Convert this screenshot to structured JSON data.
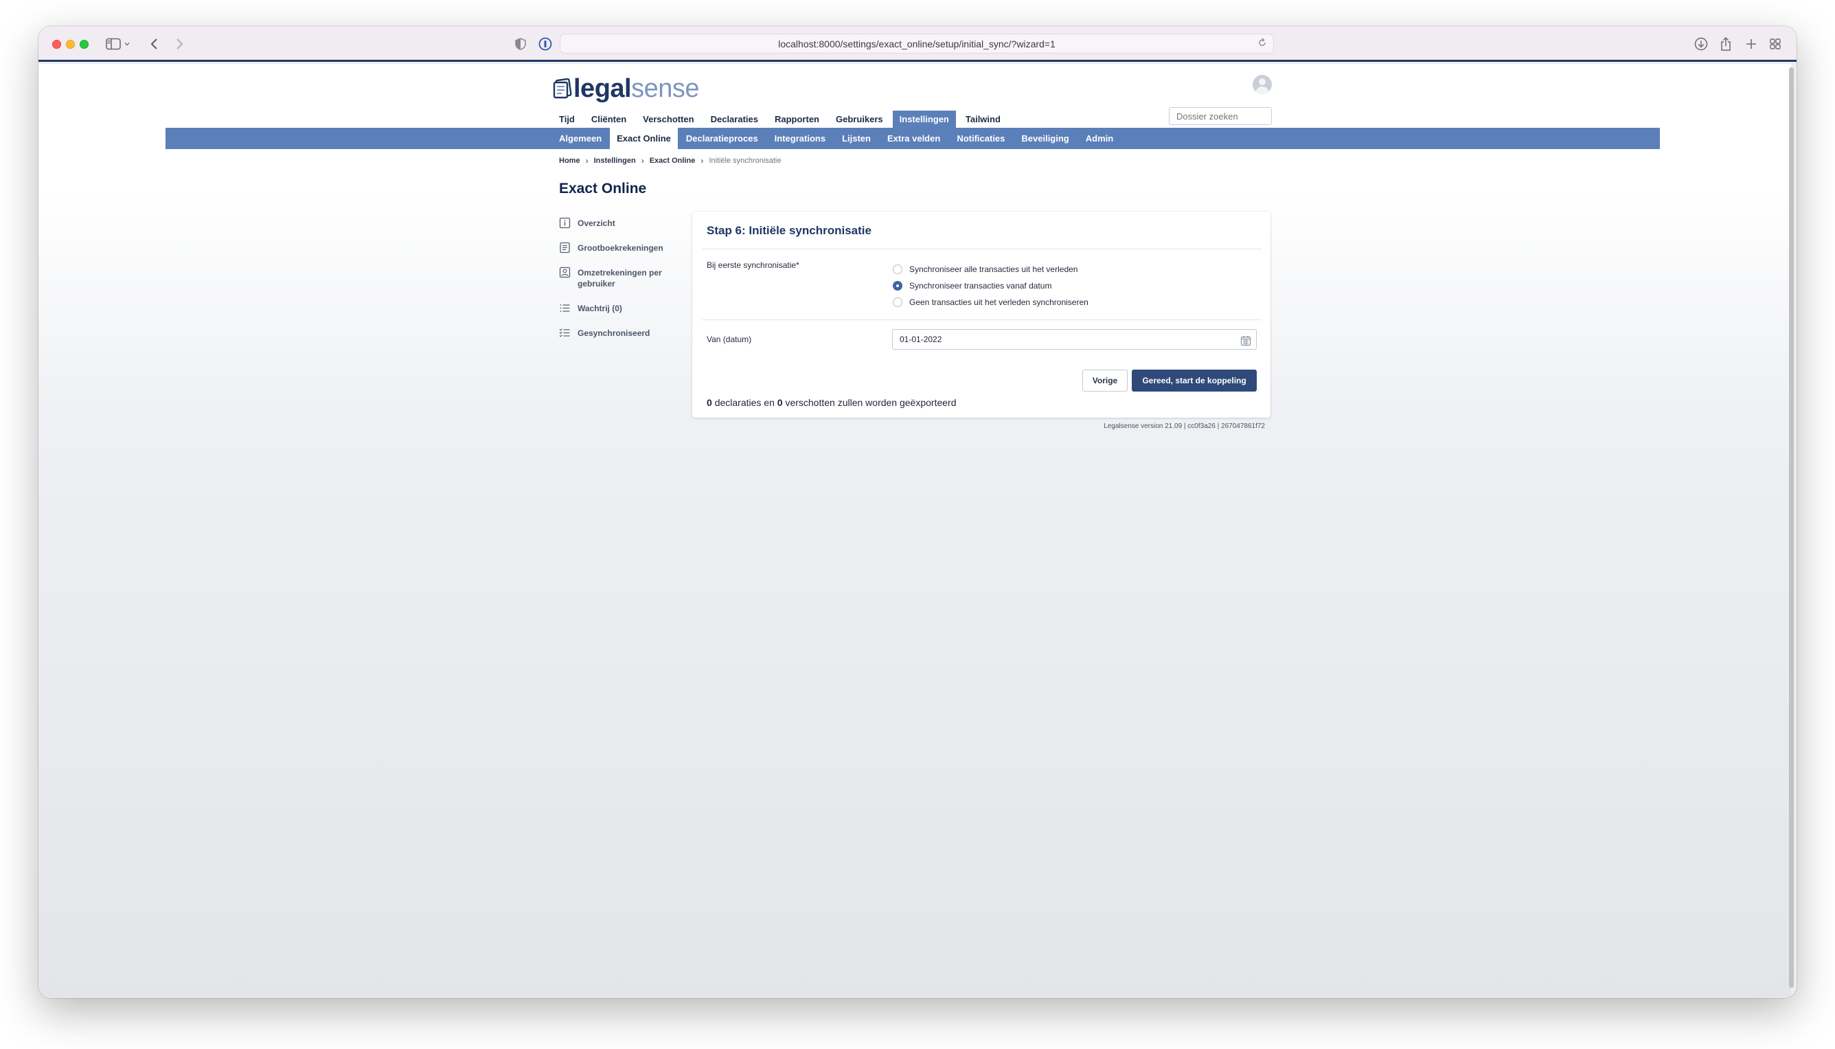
{
  "browser": {
    "url": "localhost:8000/settings/exact_online/setup/initial_sync/?wizard=1"
  },
  "header": {
    "logo_legal": "legal",
    "logo_sense": "sense",
    "search_placeholder": "Dossier zoeken"
  },
  "mainnav": [
    {
      "label": "Tijd",
      "active": false
    },
    {
      "label": "Cliënten",
      "active": false
    },
    {
      "label": "Verschotten",
      "active": false
    },
    {
      "label": "Declaraties",
      "active": false
    },
    {
      "label": "Rapporten",
      "active": false
    },
    {
      "label": "Gebruikers",
      "active": false
    },
    {
      "label": "Instellingen",
      "active": true
    },
    {
      "label": "Tailwind",
      "active": false
    }
  ],
  "subnav": [
    {
      "label": "Algemeen",
      "active": false
    },
    {
      "label": "Exact Online",
      "active": true
    },
    {
      "label": "Declaratieproces",
      "active": false
    },
    {
      "label": "Integrations",
      "active": false
    },
    {
      "label": "Lijsten",
      "active": false
    },
    {
      "label": "Extra velden",
      "active": false
    },
    {
      "label": "Notificaties",
      "active": false
    },
    {
      "label": "Beveiliging",
      "active": false
    },
    {
      "label": "Admin",
      "active": false
    }
  ],
  "breadcrumb": {
    "home": "Home",
    "settings": "Instellingen",
    "exact": "Exact Online",
    "current": "Initiële synchronisatie"
  },
  "page_title": "Exact Online",
  "sidebar": {
    "items": [
      {
        "label": "Overzicht",
        "icon": "info-icon"
      },
      {
        "label": "Grootboekrekeningen",
        "icon": "ledger-icon"
      },
      {
        "label": "Omzetrekeningen per gebruiker",
        "icon": "user-card-icon"
      },
      {
        "label": "Wachtrij (0)",
        "icon": "list-icon"
      },
      {
        "label": "Gesynchroniseerd",
        "icon": "checklist-icon"
      }
    ]
  },
  "card": {
    "title": "Stap 6: Initiële synchronisatie",
    "sync_label": "Bij eerste synchronisatie*",
    "options": [
      {
        "label": "Synchroniseer alle transacties uit het verleden",
        "checked": false
      },
      {
        "label": "Synchroniseer transacties vanaf datum",
        "checked": true
      },
      {
        "label": "Geen transacties uit het verleden synchroniseren",
        "checked": false
      }
    ],
    "date_label": "Van (datum)",
    "date_value": "01-01-2022",
    "prev_button": "Vorige",
    "go_button": "Gereed, start de koppeling",
    "summary": {
      "declaraties_count": "0",
      "declaraties_text": "declaraties en",
      "verschotten_count": "0",
      "verschotten_text": "verschotten zullen worden geëxporteerd"
    }
  },
  "footer": {
    "version": "Legalsense version 21.09 | cc0f3a26 | 267047861f72"
  },
  "colors": {
    "brand_dark": "#1f3663",
    "nav_blue": "#5b7fb9",
    "button_primary": "#2f4a7a"
  }
}
